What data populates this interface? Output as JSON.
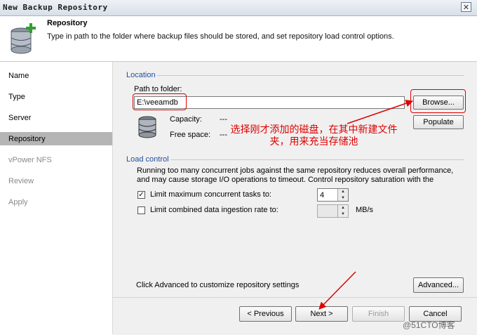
{
  "window": {
    "title": "New Backup Repository",
    "close_glyph": "✕"
  },
  "header": {
    "title": "Repository",
    "description": "Type in path to the folder where backup files should be stored, and set repository load control options.",
    "icon": "database-add-icon"
  },
  "sidebar": {
    "items": [
      {
        "label": "Name",
        "state": "done"
      },
      {
        "label": "Type",
        "state": "done"
      },
      {
        "label": "Server",
        "state": "done"
      },
      {
        "label": "Repository",
        "state": "active"
      },
      {
        "label": "vPower NFS",
        "state": "pending"
      },
      {
        "label": "Review",
        "state": "pending"
      },
      {
        "label": "Apply",
        "state": "pending"
      }
    ]
  },
  "location": {
    "section_label": "Location",
    "path_label": "Path to folder:",
    "path_value": "E:\\veeamdb",
    "browse_label": "Browse...",
    "populate_label": "Populate",
    "capacity_label": "Capacity:",
    "capacity_value": "---",
    "freespace_label": "Free space:",
    "freespace_value": "---",
    "disk_icon": "disk-icon"
  },
  "load_control": {
    "section_label": "Load control",
    "description": "Running too many concurrent jobs against the same repository reduces overall performance, and may cause storage I/O operations to timeout. Control repository saturation with the",
    "limit_tasks": {
      "label": "Limit maximum concurrent tasks to:",
      "checked": true,
      "value": "4"
    },
    "limit_rate": {
      "label": "Limit combined data ingestion rate to:",
      "checked": false,
      "value": "",
      "unit": "MB/s"
    }
  },
  "advanced": {
    "text": "Click Advanced to customize repository settings",
    "button_label": "Advanced..."
  },
  "footer": {
    "previous_label": "< Previous",
    "next_label": "Next >",
    "finish_label": "Finish",
    "cancel_label": "Cancel"
  },
  "annotation": {
    "line1": "选择刚才添加的磁盘，在其中新建文件",
    "line2": "夹，用来充当存储池",
    "color": "#e00000"
  },
  "watermark": "@51CTO博客"
}
